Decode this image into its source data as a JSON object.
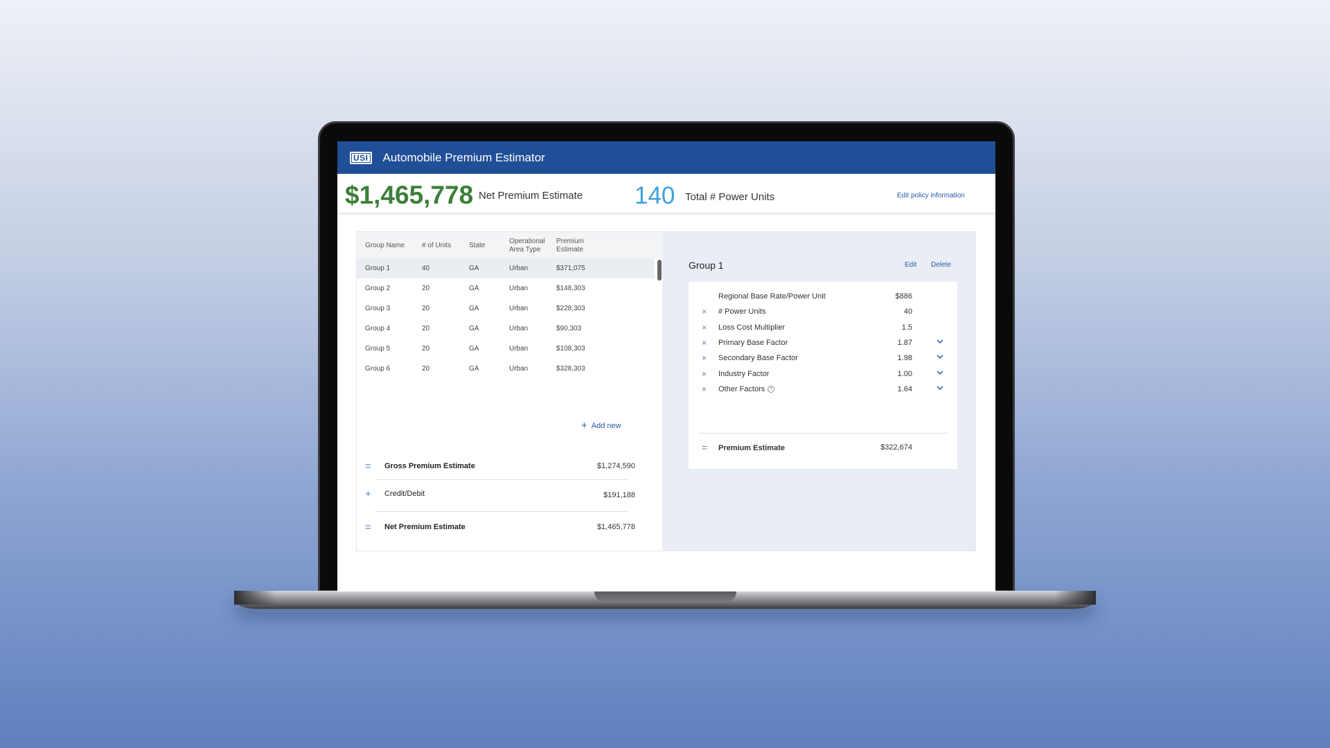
{
  "app": {
    "logo": "USI",
    "title": "Automobile Premium Estimator"
  },
  "summary": {
    "net_premium": "$1,465,778",
    "net_premium_label": "Net Premium Estimate",
    "power_units": "140",
    "power_units_label": "Total # Power Units",
    "edit_policy": "Edit policy information"
  },
  "table": {
    "headers": [
      "Group Name",
      "# of Units",
      "State",
      "Operational Area Type",
      "Premium Estimate"
    ],
    "rows": [
      [
        "Group 1",
        "40",
        "GA",
        "Urban",
        "$371,075"
      ],
      [
        "Group 2",
        "20",
        "GA",
        "Urban",
        "$148,303"
      ],
      [
        "Group 3",
        "20",
        "GA",
        "Urban",
        "$228,303"
      ],
      [
        "Group 4",
        "20",
        "GA",
        "Urban",
        "$90,303"
      ],
      [
        "Group 5",
        "20",
        "GA",
        "Urban",
        "$108,303"
      ],
      [
        "Group 6",
        "20",
        "GA",
        "Urban",
        "$328,303"
      ]
    ],
    "add_new": "Add new"
  },
  "totals": [
    {
      "symbol": "=",
      "label": "Gross Premium Estimate",
      "value": "$1,274,590"
    },
    {
      "symbol": "+",
      "label": "Credit/Debit",
      "value": "$191,188"
    },
    {
      "symbol": "=",
      "label": "Net Premium Estimate",
      "value": "$1,465,778"
    }
  ],
  "detail": {
    "title": "Group 1",
    "edit": "Edit",
    "delete": "Delete",
    "factors": [
      {
        "label": "Regional Base Rate/Power Unit",
        "value": "$886"
      },
      {
        "label": "# Power Units",
        "value": "40"
      },
      {
        "label": "Loss Cost Multiplier",
        "value": "1.5"
      },
      {
        "label": "Primary Base Factor",
        "value": "1.87"
      },
      {
        "label": "Secondary Base Factor",
        "value": "1.98"
      },
      {
        "label": "Industry Factor",
        "value": "1.00"
      },
      {
        "label": "Other Factors",
        "value": "1.64"
      }
    ],
    "result": {
      "symbol": "=",
      "label": "Premium Estimate",
      "value": "$322,674"
    }
  },
  "icons": {
    "multiply": "×",
    "plus": "+",
    "help": "?"
  },
  "colors": {
    "header_bg": "#204f97",
    "net_premium": "#3d7f3a",
    "power_units": "#3fa0de",
    "link": "#2557a7"
  }
}
